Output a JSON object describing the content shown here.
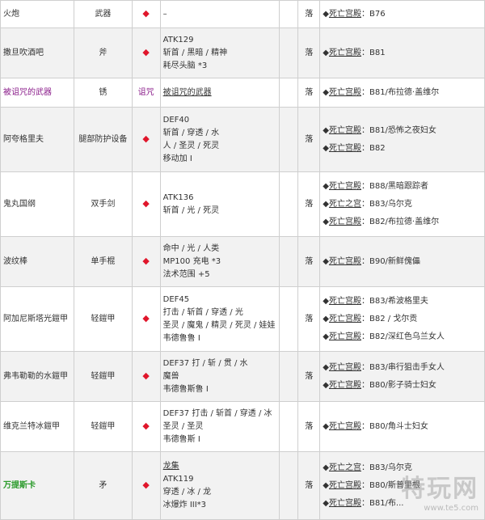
{
  "rows": [
    {
      "name": "火炮",
      "type": "武器",
      "mark": "◆",
      "stats": [
        "–"
      ],
      "drop": "落",
      "sources": [
        {
          "loc": "死亡宫殿",
          "rest": "：B76"
        }
      ],
      "h": 34,
      "alt": false,
      "color": ""
    },
    {
      "name": "撒旦吹酒吧",
      "type": "斧",
      "mark": "◆",
      "stats": [
        "ATK129",
        "斩首 / 黑暗 / 精神",
        "耗尽头脑 *3"
      ],
      "drop": "落",
      "sources": [
        {
          "loc": "死亡宫殿",
          "rest": "：B81"
        }
      ],
      "h": 62,
      "alt": true,
      "color": ""
    },
    {
      "name": "被诅咒的武器",
      "type": "锈",
      "mark": "诅咒",
      "stats": [
        "被诅咒的武器"
      ],
      "drop": "落",
      "sources": [
        {
          "loc": "死亡宫殿",
          "rest": "：B81/布拉德·盖维尔"
        }
      ],
      "h": 36,
      "alt": false,
      "color": "purple"
    },
    {
      "name": "阿夸格里夫",
      "type": "腿部防护设备",
      "mark": "◆",
      "stats": [
        "DEF40",
        "斩首 / 穿透 / 水",
        "人 / 圣灵 / 死灵",
        "移动加 I"
      ],
      "drop": "落",
      "sources": [
        {
          "loc": "死亡宫殿",
          "rest": "：B81/恐怖之夜妇女"
        },
        {
          "loc": "死亡宫殿",
          "rest": "：B82"
        }
      ],
      "h": 80,
      "alt": true,
      "color": ""
    },
    {
      "name": "鬼丸国纲",
      "type": "双手剑",
      "mark": "◆",
      "stats": [
        "ATK136",
        "斩首 / 光 / 死灵"
      ],
      "drop": "落",
      "sources": [
        {
          "loc": "死亡宫殿",
          "rest": "：B88/黑暗跟踪者"
        },
        {
          "loc": "死亡之宫",
          "rest": "：B83/乌尔克"
        },
        {
          "loc": "死亡宫殿",
          "rest": "：B82/布拉德·盖维尔"
        }
      ],
      "h": 80,
      "alt": false,
      "color": ""
    },
    {
      "name": "波纹棒",
      "type": "单手棍",
      "mark": "◆",
      "stats": [
        "命中 / 光 / 人类",
        "MP100 充电 *3",
        "法术范围 +5"
      ],
      "drop": "落",
      "sources": [
        {
          "loc": "死亡宫殿",
          "rest": "：B90/新鲜傀儡"
        }
      ],
      "h": 62,
      "alt": true,
      "color": ""
    },
    {
      "name": "阿加尼斯塔光鎧甲",
      "type": "轻鎧甲",
      "mark": "◆",
      "stats": [
        "DEF45",
        "打击 / 斩首 / 穿透 / 光",
        "圣灵 / 魔鬼 / 精灵 / 死灵 / 娃娃",
        "韦德鲁鲁 I"
      ],
      "drop": "落",
      "sources": [
        {
          "loc": "死亡宫殿",
          "rest": "：B83/希波格里夫"
        },
        {
          "loc": "死亡宫殿",
          "rest": "：B82 / 戈尔贡"
        },
        {
          "loc": "死亡宫殿",
          "rest": "：B82/深红色乌兰女人"
        }
      ],
      "h": 80,
      "alt": false,
      "color": ""
    },
    {
      "name": "弗韦勒勒的水鎧甲",
      "type": "轻鎧甲",
      "mark": "◆",
      "stats": [
        "DEF37 打 / 斩 / 贯 / 水",
        "魔兽",
        "韦德鲁斯鲁 I"
      ],
      "drop": "落",
      "sources": [
        {
          "loc": "死亡宫殿",
          "rest": "：B83/串行狙击手女人"
        },
        {
          "loc": "死亡宫殿",
          "rest": "：B80/影子骑士妇女"
        }
      ],
      "h": 62,
      "alt": true,
      "color": ""
    },
    {
      "name": "维克兰特冰鎧甲",
      "type": "轻鎧甲",
      "mark": "◆",
      "stats": [
        "DEF37 打击 / 斩首 / 穿透 / 冰",
        "圣灵 / 圣灵",
        "韦德鲁斯 I"
      ],
      "drop": "落",
      "sources": [
        {
          "loc": "死亡宫殿",
          "rest": "：B80/角斗士妇女"
        }
      ],
      "h": 62,
      "alt": false,
      "color": ""
    },
    {
      "name": "万提斯卡",
      "type": "矛",
      "mark": "◆",
      "stats": [
        "龙集",
        "ATK119",
        "穿透 / 冰 / 龙",
        "冰爆炸 III*3"
      ],
      "drop": "落",
      "sources": [
        {
          "loc": "死亡之宫",
          "rest": "：B83/乌尔克"
        },
        {
          "loc": "死亡宫殿",
          "rest": "：B80/斯普里根"
        },
        {
          "loc": "死亡宫殿",
          "rest": "：B81/布..."
        }
      ],
      "h": 84,
      "alt": true,
      "color": "green"
    }
  ],
  "watermark": {
    "logo": "特玩网",
    "url": "www.te5.com"
  }
}
